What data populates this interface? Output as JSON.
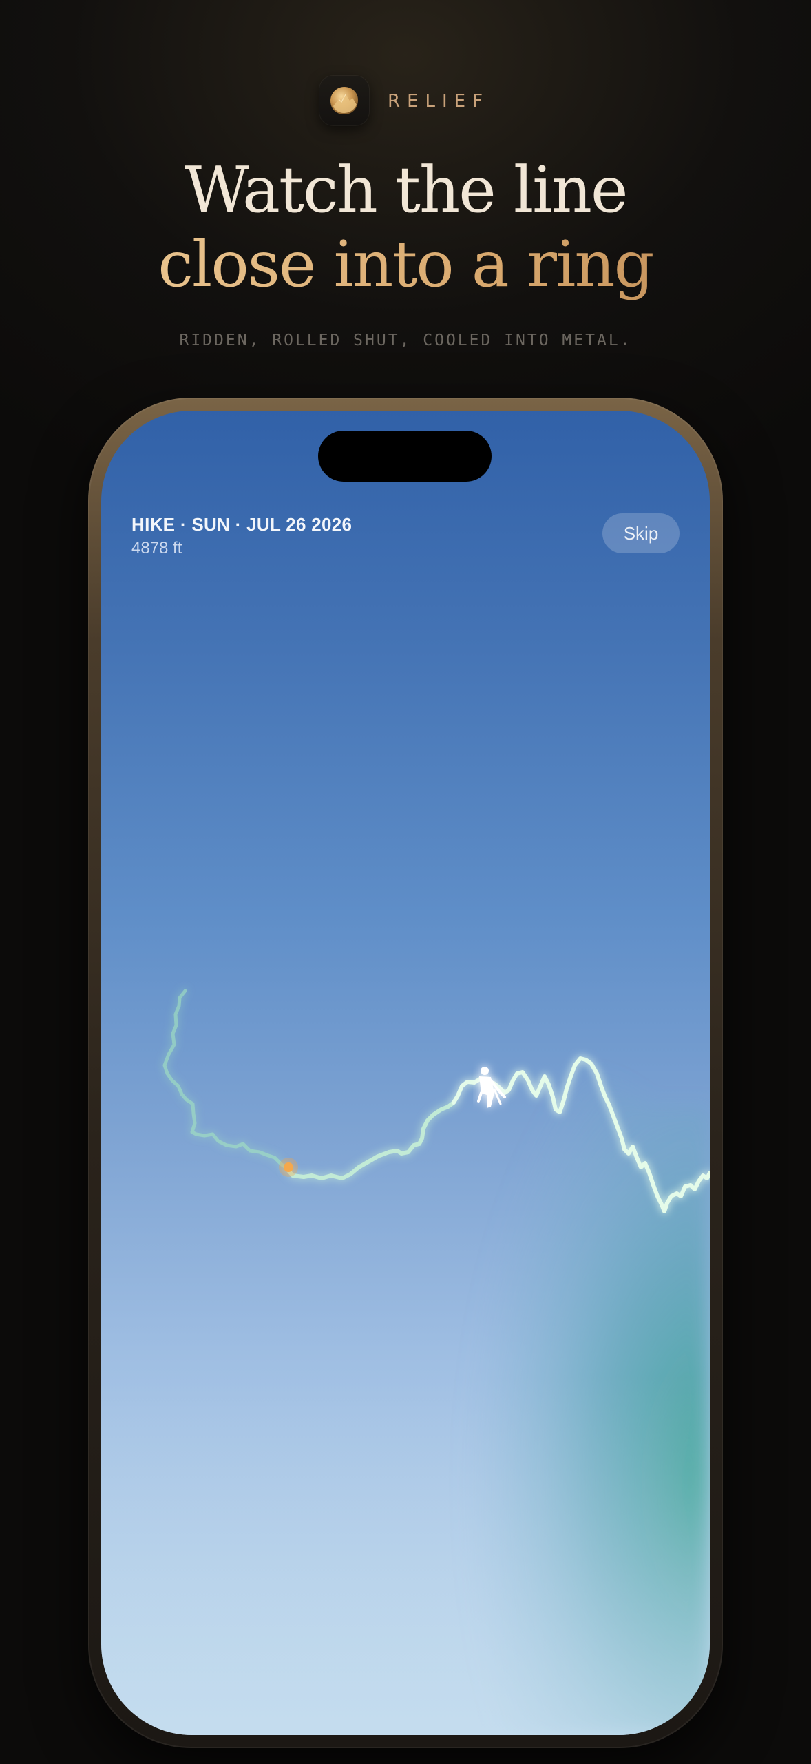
{
  "brand": {
    "name": "RELIEF",
    "icon": "mountain-medallion-icon"
  },
  "headline": {
    "line1": "Watch the line",
    "line2": "close into a ring"
  },
  "subhead": "RIDDEN, ROLLED SHUT, COOLED INTO METAL.",
  "phone": {
    "activity_title": "HIKE · SUN · JUL 26 2026",
    "elevation": "4878 ft",
    "skip_label": "Skip",
    "trace_color": "#9ff3c0",
    "marker_color": "#f0a24a",
    "hiker_icon": "hiker-figure-icon"
  }
}
